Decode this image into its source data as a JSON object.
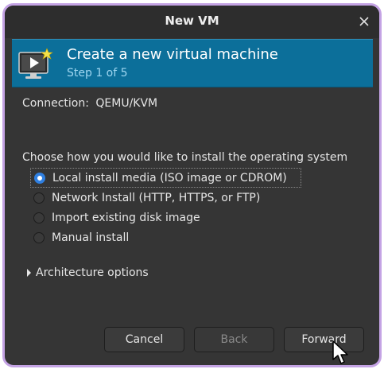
{
  "window": {
    "title": "New VM"
  },
  "banner": {
    "title": "Create a new virtual machine",
    "step": "Step 1 of 5"
  },
  "connection": {
    "label": "Connection:",
    "value": "QEMU/KVM"
  },
  "install": {
    "prompt": "Choose how you would like to install the operating system",
    "options": [
      {
        "label": "Local install media (ISO image or CDROM)",
        "selected": true
      },
      {
        "label": "Network Install (HTTP, HTTPS, or FTP)",
        "selected": false
      },
      {
        "label": "Import existing disk image",
        "selected": false
      },
      {
        "label": "Manual install",
        "selected": false
      }
    ]
  },
  "expander": {
    "label": "Architecture options"
  },
  "buttons": {
    "cancel": "Cancel",
    "back": "Back",
    "forward": "Forward"
  },
  "colors": {
    "window_border": "#c4a3e4",
    "banner_bg": "#0c6f9a",
    "radio_accent": "#2f7fe0"
  }
}
